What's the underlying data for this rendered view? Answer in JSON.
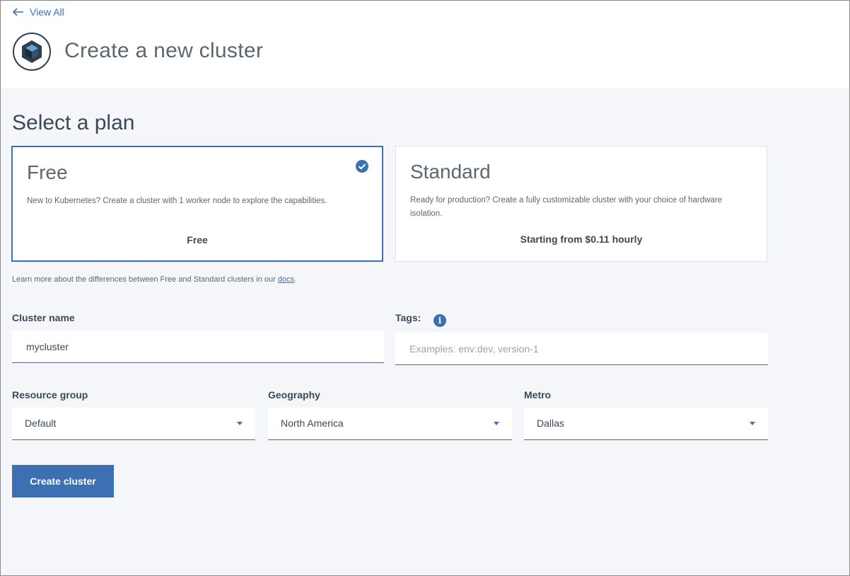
{
  "header": {
    "back_label": "View All",
    "title": "Create a new cluster"
  },
  "plans": {
    "section_title": "Select a plan",
    "items": [
      {
        "name": "Free",
        "description": "New to Kubernetes? Create a cluster with 1 worker node to explore the capabilities.",
        "price": "Free",
        "selected": true
      },
      {
        "name": "Standard",
        "description": "Ready for production? Create a fully customizable cluster with your choice of hardware isolation.",
        "price": "Starting from $0.11 hourly",
        "selected": false
      }
    ],
    "learn_more_text": "Learn more about the differences between Free and Standard clusters in our ",
    "learn_more_link": "docs",
    "learn_more_end": "."
  },
  "form": {
    "cluster_name": {
      "label": "Cluster name",
      "value": "mycluster"
    },
    "tags": {
      "label": "Tags:",
      "placeholder": "Examples: env:dev, version-1",
      "info_icon": "i"
    },
    "resource_group": {
      "label": "Resource group",
      "value": "Default"
    },
    "geography": {
      "label": "Geography",
      "value": "North America"
    },
    "metro": {
      "label": "Metro",
      "value": "Dallas"
    }
  },
  "actions": {
    "create_label": "Create cluster"
  },
  "colors": {
    "accent": "#3d70b2",
    "text": "#3a4a56",
    "background": "#f4f6f9"
  }
}
